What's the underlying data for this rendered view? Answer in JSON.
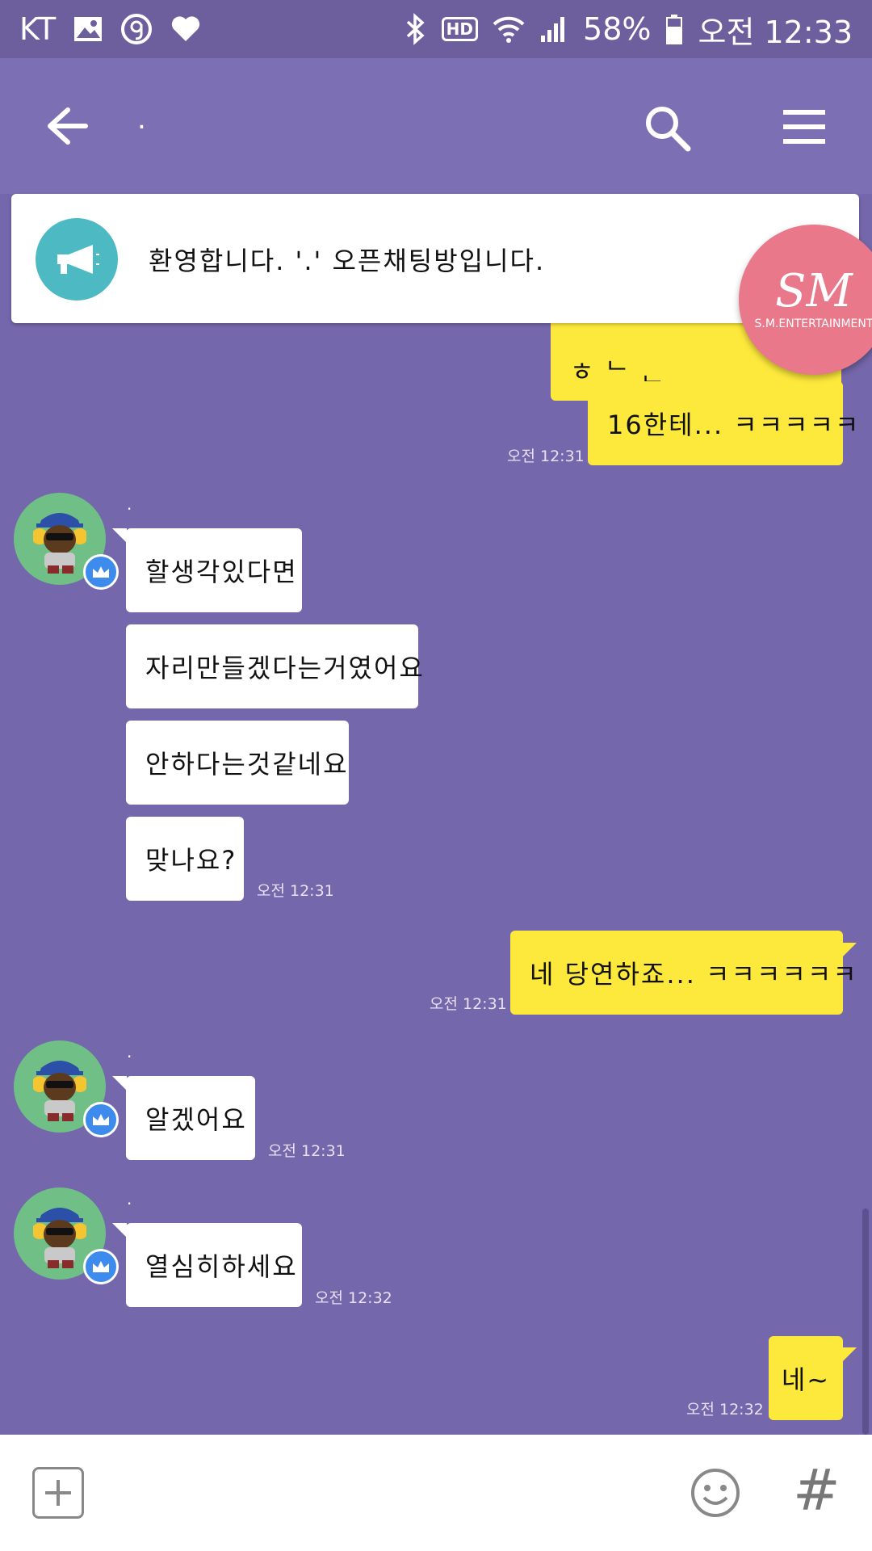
{
  "status_bar": {
    "carrier": "KT",
    "battery": "58%",
    "time": "오전 12:33",
    "hd_label": "HD",
    "icons": [
      "gallery-icon",
      "g-icon",
      "heart-icon",
      "bluetooth-icon",
      "hd-icon",
      "wifi-icon",
      "signal-icon",
      "battery-icon"
    ]
  },
  "header": {
    "title": "."
  },
  "notice": {
    "text": "환영합니다. '.' 오픈채팅방입니다."
  },
  "floating_badge": {
    "logo": "SM",
    "label": "S.M.ENTERTAINMENT"
  },
  "messages": {
    "m0": {
      "text": "ㅎ ᄂ ᆫ"
    },
    "m1": {
      "text": "16한테... ㅋㅋㅋㅋㅋ",
      "time": "오전 12:31"
    },
    "sender1": {
      "name": "."
    },
    "m2": {
      "text": "할생각있다면"
    },
    "m3": {
      "text": "자리만들겠다는거였어요"
    },
    "m4": {
      "text": "안하다는것같네요"
    },
    "m5": {
      "text": "맞나요?",
      "time": "오전 12:31"
    },
    "m6": {
      "text": "네 당연하죠... ㅋㅋㅋㅋㅋㅋ",
      "time": "오전 12:31"
    },
    "sender2": {
      "name": "."
    },
    "m7": {
      "text": "알겠어요",
      "time": "오전 12:31"
    },
    "sender3": {
      "name": "."
    },
    "m8": {
      "text": "열심히하세요",
      "time": "오전 12:32"
    },
    "m9": {
      "text": "네~",
      "time": "오전 12:32"
    }
  },
  "input_bar": {
    "icons": [
      "plus-icon",
      "emoji-icon",
      "hash-icon"
    ],
    "hash_label": "#"
  },
  "colors": {
    "background": "#7567ab",
    "header": "#7d6fb3",
    "my_bubble": "#fde93c",
    "their_bubble": "#ffffff",
    "notice_icon": "#4cb9c3",
    "badge": "#e9788a",
    "crown_badge": "#3d8bec"
  }
}
